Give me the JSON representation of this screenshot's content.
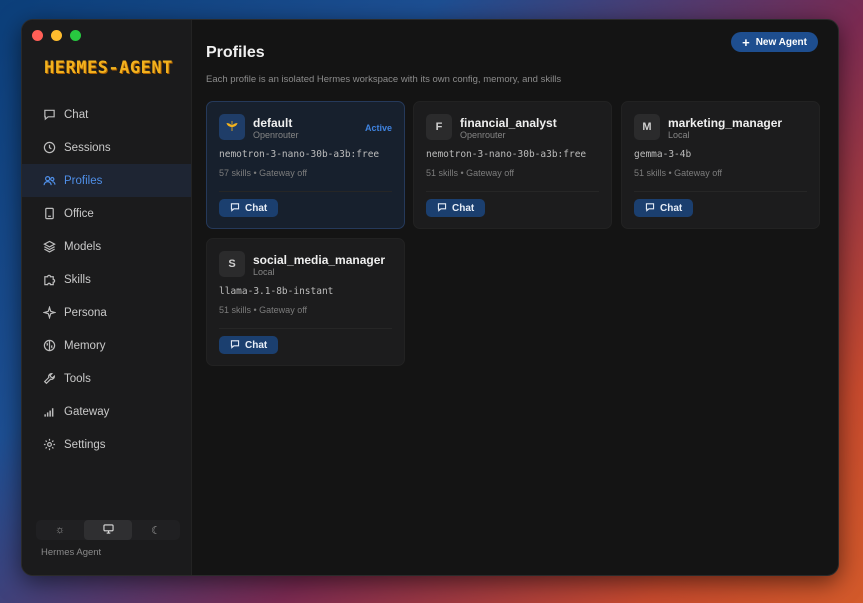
{
  "app": {
    "logo": "HERMES-AGENT",
    "footer": "Hermes Agent"
  },
  "sidebar": {
    "items": [
      {
        "label": "Chat",
        "icon": "chat-icon"
      },
      {
        "label": "Sessions",
        "icon": "clock-icon"
      },
      {
        "label": "Profiles",
        "icon": "users-icon",
        "active": true
      },
      {
        "label": "Office",
        "icon": "office-icon"
      },
      {
        "label": "Models",
        "icon": "layers-icon"
      },
      {
        "label": "Skills",
        "icon": "puzzle-icon"
      },
      {
        "label": "Persona",
        "icon": "sparkle-icon"
      },
      {
        "label": "Memory",
        "icon": "brain-icon"
      },
      {
        "label": "Tools",
        "icon": "wrench-icon"
      },
      {
        "label": "Gateway",
        "icon": "signal-icon"
      },
      {
        "label": "Settings",
        "icon": "gear-icon"
      }
    ],
    "theme_options": [
      "light",
      "system",
      "dark"
    ],
    "theme_selected": "system"
  },
  "main": {
    "title": "Profiles",
    "subtitle": "Each profile is an isolated Hermes workspace with its own config, memory, and skills",
    "new_agent_label": "New Agent",
    "profiles": [
      {
        "initial": "",
        "name": "default",
        "provider": "Openrouter",
        "badge": "Active",
        "model": "nemotron-3-nano-30b-a3b:free",
        "skills": "57 skills",
        "gateway": "Gateway off",
        "chat_label": "Chat"
      },
      {
        "initial": "F",
        "name": "financial_analyst",
        "provider": "Openrouter",
        "badge": "",
        "model": "nemotron-3-nano-30b-a3b:free",
        "skills": "51 skills",
        "gateway": "Gateway off",
        "chat_label": "Chat"
      },
      {
        "initial": "M",
        "name": "marketing_manager",
        "provider": "Local",
        "badge": "",
        "model": "gemma-3-4b",
        "skills": "51 skills",
        "gateway": "Gateway off",
        "chat_label": "Chat"
      },
      {
        "initial": "S",
        "name": "social_media_manager",
        "provider": "Local",
        "badge": "",
        "model": "llama-3.1-8b-instant",
        "skills": "51 skills",
        "gateway": "Gateway off",
        "chat_label": "Chat"
      }
    ]
  },
  "colors": {
    "accent": "#3f83e0",
    "logo": "#f2b21e",
    "button": "#1e4e8f"
  }
}
